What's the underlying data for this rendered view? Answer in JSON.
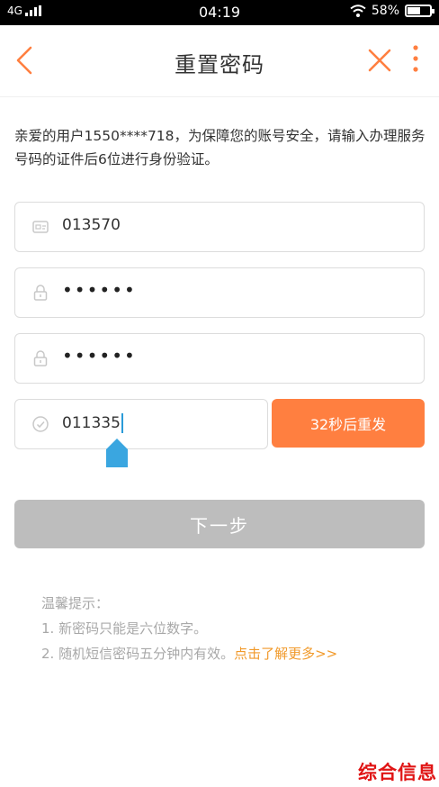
{
  "status_bar": {
    "network": "4G",
    "time": "04:19",
    "battery": "58%",
    "battery_level": 0.58
  },
  "nav": {
    "title": "重置密码",
    "back_icon": "chevron-left-icon",
    "close_icon": "close-icon",
    "more_icon": "more-vertical-icon"
  },
  "info": {
    "text": "亲爱的用户1550****718，为保障您的账号安全，请输入办理服务号码的证件后6位进行身份验证。"
  },
  "form": {
    "id_field": {
      "icon": "id-card-icon",
      "value": "013570"
    },
    "password_field": {
      "icon": "lock-icon",
      "value": "••••••"
    },
    "confirm_field": {
      "icon": "lock-icon",
      "value": "••••••"
    },
    "code_field": {
      "icon": "clock-icon",
      "value": "011335"
    },
    "resend_label": "32秒后重发",
    "next_label": "下一步"
  },
  "tips": {
    "heading": "温馨提示：",
    "item1": "1. 新密码只能是六位数字。",
    "item2": "2. 随机短信密码五分钟内有效。",
    "link": "点击了解更多>>"
  },
  "watermark": "综合信息",
  "colors": {
    "accent": "#ff7f40",
    "link": "#f19a2b",
    "disabled_button": "#bdbdbd",
    "watermark": "#e01414"
  }
}
